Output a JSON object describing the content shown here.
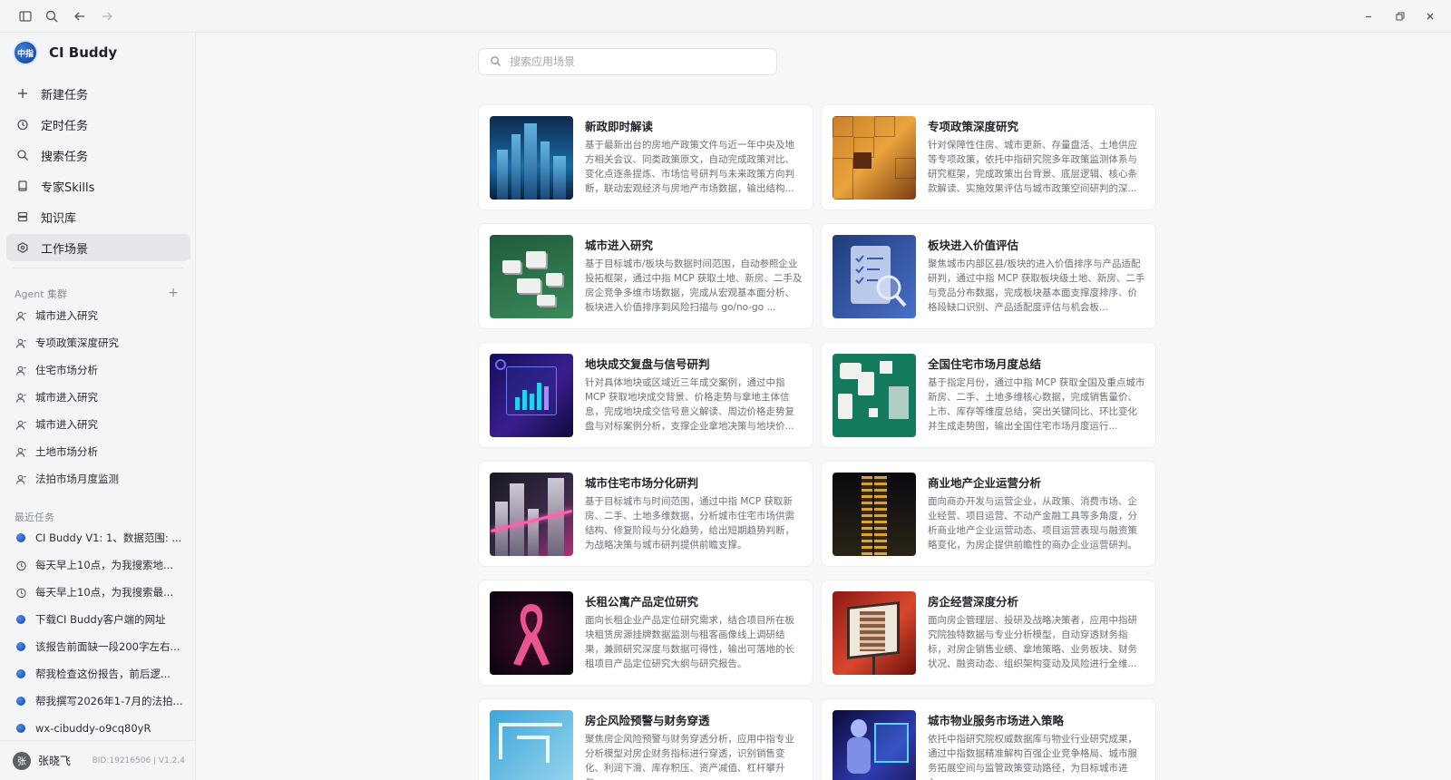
{
  "app": {
    "name": "CI Buddy",
    "logo_text": "中指"
  },
  "nav": [
    {
      "label": "新建任务",
      "icon": "plus-icon"
    },
    {
      "label": "定时任务",
      "icon": "clock-icon"
    },
    {
      "label": "搜索任务",
      "icon": "search-icon"
    },
    {
      "label": "专家Skills",
      "icon": "book-icon"
    },
    {
      "label": "知识库",
      "icon": "database-icon"
    },
    {
      "label": "工作场景",
      "icon": "hexagon-icon",
      "active": true
    }
  ],
  "agents": {
    "title": "Agent 集群",
    "items": [
      "城市进入研究",
      "专项政策深度研究",
      "住宅市场分析",
      "城市进入研究",
      "城市进入研究",
      "土地市场分析",
      "法拍市场月度监测"
    ]
  },
  "recent": {
    "title": "最近任务",
    "items": [
      {
        "label": "CI Buddy V1: 1、数据范围: ...",
        "icon": "globe-dot-icon"
      },
      {
        "label": "每天早上10点，为我搜索地...",
        "icon": "clock-icon"
      },
      {
        "label": "每天早上10点，为我搜索最...",
        "icon": "clock-icon"
      },
      {
        "label": "下载CI Buddy客户端的网址",
        "icon": "globe-dot-icon"
      },
      {
        "label": "该报告前面缺一段200字左右...",
        "icon": "globe-dot-icon"
      },
      {
        "label": "帮我检查这份报告，前后逻...",
        "icon": "globe-dot-icon"
      },
      {
        "label": "帮我撰写2026年1-7月的法拍...",
        "icon": "globe-dot-icon"
      },
      {
        "label": "wx-cibuddy-o9cq80yR",
        "icon": "globe-dot-icon"
      }
    ]
  },
  "user": {
    "avatar": "张",
    "name": "张晓飞",
    "meta": "BID:19216506 | V1.2.4"
  },
  "search": {
    "placeholder": "搜索应用场景"
  },
  "cards": [
    {
      "title": "新政即时解读",
      "desc": "基于最新出台的房地产政策文件与近一年中央及地方相关会议、同类政策原文，自动完成政策对比、变化点逐条提炼、市场信号研判与未来政策方向判断，联动宏观经济与房地产市场数据，输出结构...",
      "thumb": "city-skyline"
    },
    {
      "title": "专项政策深度研究",
      "desc": "针对保障性住房、城市更新、存量盘活、土地供应等专项政策，依托中指研究院多年政策监测体系与研究框架，完成政策出台背景、底层逻辑、核心条款解读、实施效果评估与城市政策空间研判的深...",
      "thumb": "gold-grid"
    },
    {
      "title": "城市进入研究",
      "desc": "基于目标城市/板块与数据时间范围，自动参照企业投拓框架，通过中指 MCP 获取土地、新房、二手及房企竞争多维市场数据，完成从宏观基本面分析、板块进入价值排序到风险扫描与 go/no-go ...",
      "thumb": "isometric-city"
    },
    {
      "title": "板块进入价值评估",
      "desc": "聚焦城市内部区县/板块的进入价值排序与产品适配研判，通过中指 MCP 获取板块级土地、新房、二手与竞品分布数据，完成板块基本面支撑度排序、价格段缺口识别、产品适配度评估与机会板...",
      "thumb": "checklist-magnifier"
    },
    {
      "title": "地块成交复盘与信号研判",
      "desc": "针对具体地块或区域近三年成交案例，通过中指 MCP 获取地块成交背景、价格走势与拿地主体信息，完成地块成交信号意义解读、周边价格走势复盘与对标案例分析，支撑企业拿地决策与地块价...",
      "thumb": "dashboard-chart"
    },
    {
      "title": "全国住宅市场月度总结",
      "desc": "基于指定月份，通过中指 MCP 获取全国及重点城市新房、二手、土地多维核心数据，完成销售量价、上市、库存等维度总结，突出关键同比、环比变化并生成走势图，输出全国住宅市场月度运行...",
      "thumb": "china-map"
    },
    {
      "title": "城市住宅市场分化研判",
      "desc": "基于目标城市与时间范围，通过中指 MCP 获取新房、二手、土地多维数据，分析城市住宅市场供需结构、修复阶段与分化趋势，给出短期趋势判断，为战略决策与城市研判提供前瞻支撑。",
      "thumb": "dark-towers"
    },
    {
      "title": "商业地产企业运营分析",
      "desc": "面向商办开发与运营企业，从政策、消费市场、企业经营、项目运营、不动产金融工具等多角度，分析商业地产企业运营动态、项目运营表现与融资策略变化，为房企提供前瞻性的商办企业运营研判。",
      "thumb": "night-tower"
    },
    {
      "title": "长租公寓产品定位研究",
      "desc": "面向长租企业产品定位研究需求，结合项目所在板块租赁房源挂牌数据监测与租客画像线上调研结果，兼顾研究深度与数据可得性，输出可落地的长租项目产品定位研究大纲与研究报告。",
      "thumb": "pink-ribbon"
    },
    {
      "title": "房企经营深度分析",
      "desc": "面向房企管理层、投研及战略决策者，应用中指研究院独特数据与专业分析模型，自动穿透财务指标，对房企销售业绩、拿地策略、业务板块、财务状况、融资动态、组织架构变动及风险进行全维...",
      "thumb": "billboard-building"
    },
    {
      "title": "房企风险预警与财务穿透",
      "desc": "聚焦房企风险预警与财务穿透分析，应用中指专业分析模型对房企财务指标进行穿透，识别销售变化、利润下滑、库存积压、资产减值、杠杆攀升与...",
      "thumb": "blue-maze"
    },
    {
      "title": "城市物业服务市场进入策略",
      "desc": "依托中指研究院权威数据库与物业行业研究成果，通过中指数据精准解构百强企业竞争格局、城市服务拓展空间与监管政策变动路径，为目标城市进入...",
      "thumb": "robot-screen"
    }
  ],
  "colors": {
    "accent": "#1f6fd6",
    "sidebar_bg": "#f4f5f7",
    "main_bg": "#f6f7f9"
  }
}
